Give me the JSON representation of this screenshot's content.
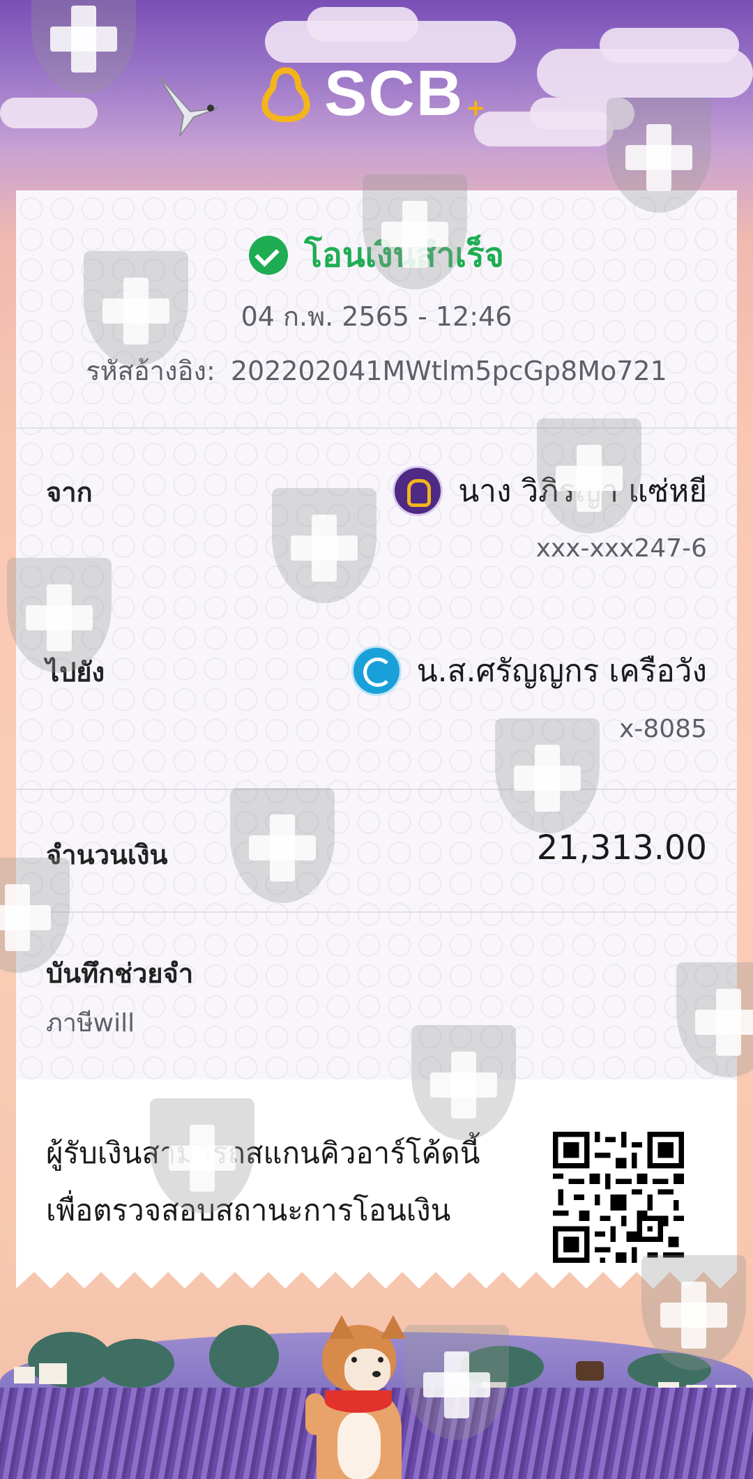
{
  "brand": {
    "logo_text": "SCB",
    "accent": "#4e2a84",
    "gold": "#f3b51b"
  },
  "status": {
    "text": "โอนเงินสำเร็จ",
    "color": "#1fad53"
  },
  "datetime": "04 ก.พ. 2565 - 12:46",
  "reference": {
    "label": "รหัสอ้างอิง:",
    "value": "202202041MWtlm5pcGp8Mo721"
  },
  "from": {
    "label": "จาก",
    "name": "นาง วิภิรญา แซ่หยี",
    "account": "xxx-xxx247-6",
    "bank_icon": "scb-bank-icon"
  },
  "to": {
    "label": "ไปยัง",
    "name": "น.ส.ศรัญญกร เครือวัง",
    "account": "x-8085",
    "bank_icon": "ktb-bank-icon"
  },
  "amount": {
    "label": "จำนวนเงิน",
    "value": "21,313.00"
  },
  "memo": {
    "label": "บันทึกช่วยจำ",
    "value": "ภาษีwill"
  },
  "verify": {
    "line1": "ผู้รับเงินสามารถสแกนคิวอาร์โค้ดนี้",
    "line2": "เพื่อตรวจสอบสถานะการโอนเงิน",
    "qr_icon": "qr-code"
  }
}
